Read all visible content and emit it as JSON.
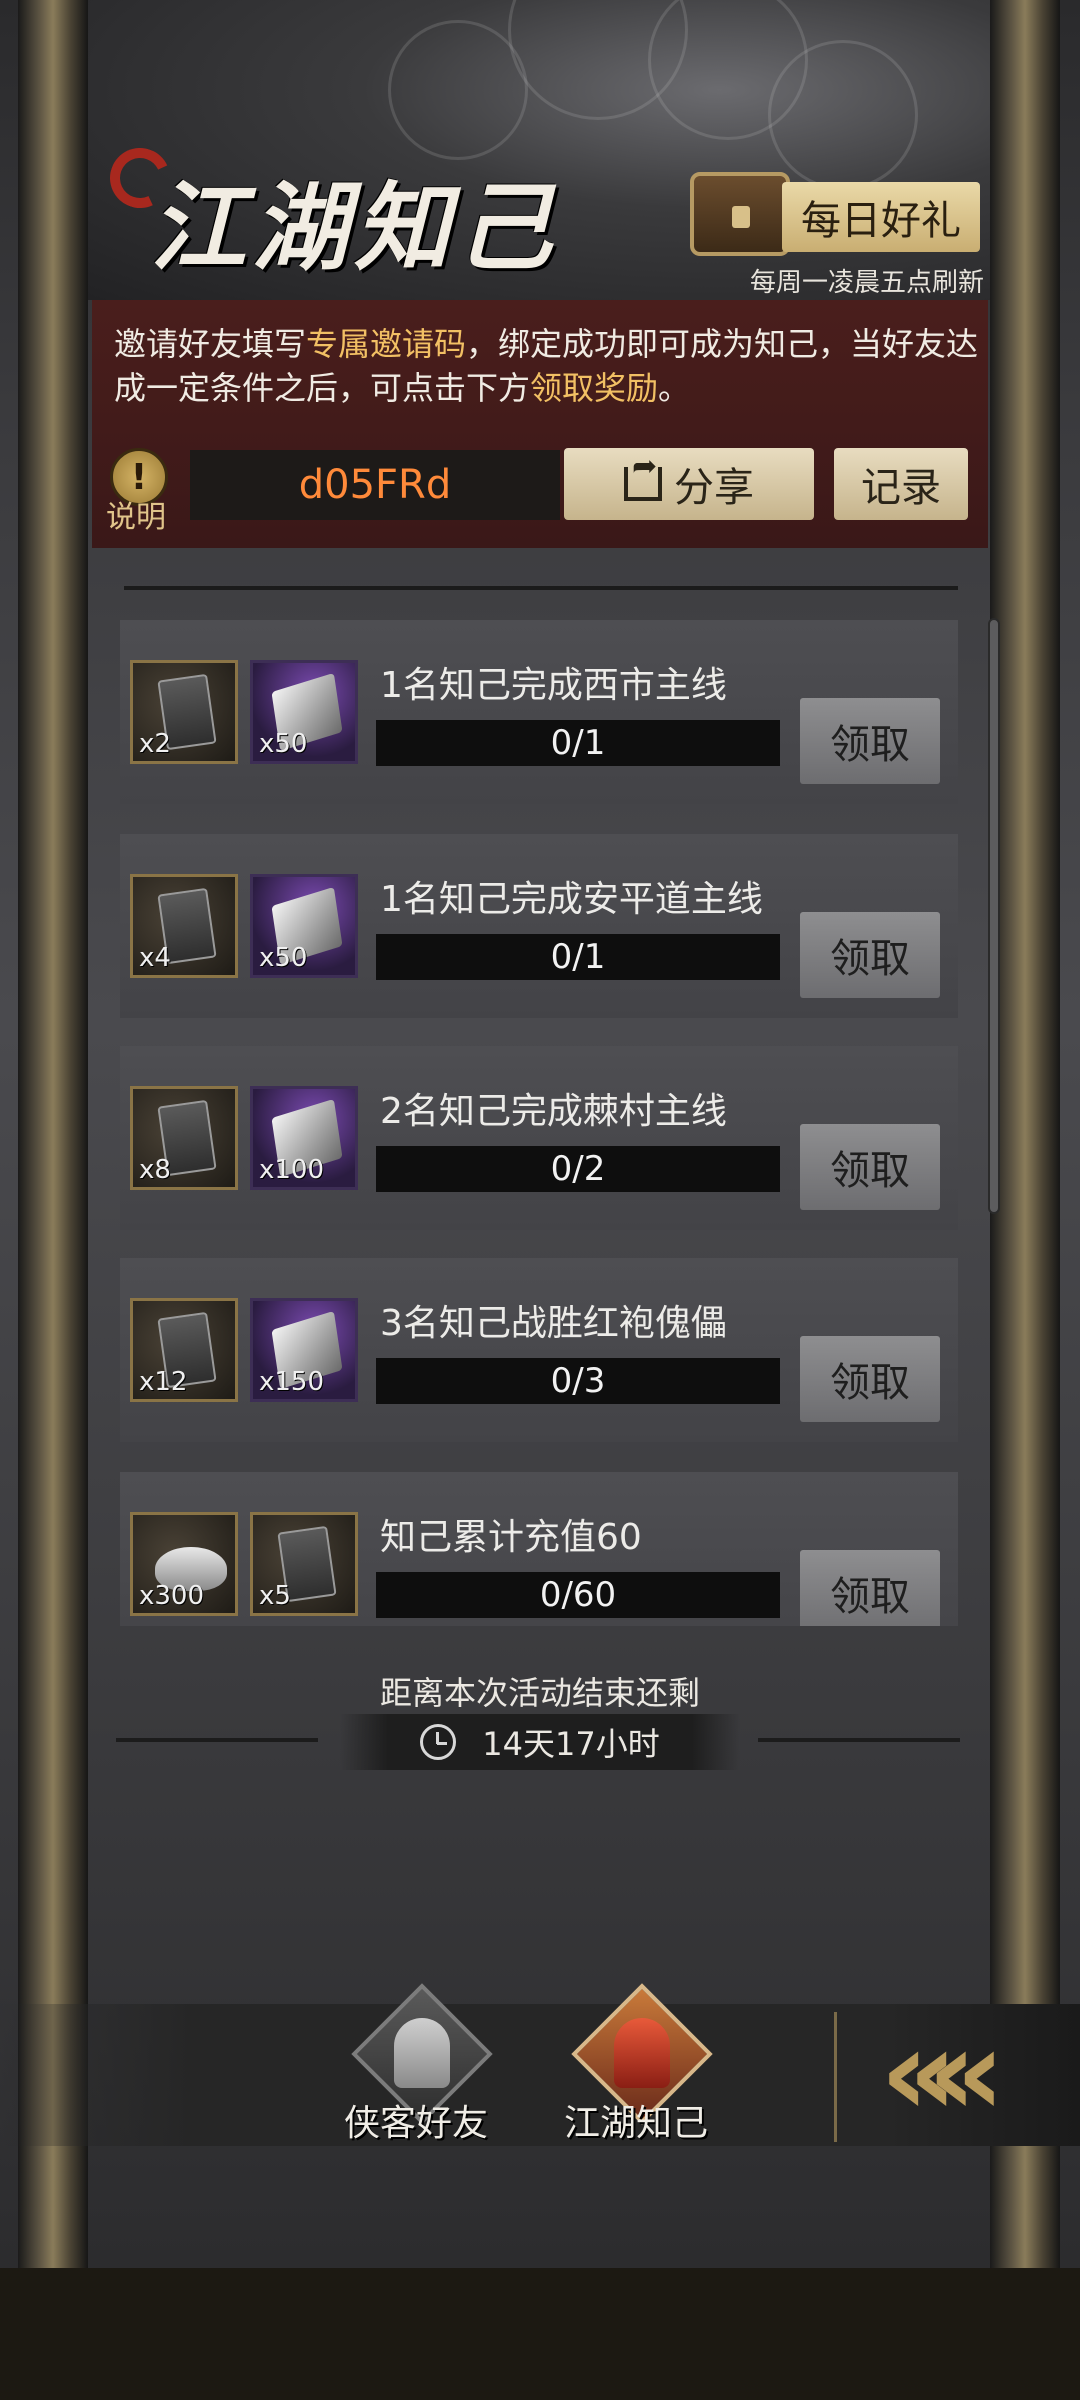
{
  "header": {
    "title": "江湖知己",
    "daily_gift_label": "每日好礼",
    "refresh_note": "每周一凌晨五点刷新"
  },
  "invite": {
    "text_part1": "邀请好友填写",
    "text_highlight1": "专属邀请码",
    "text_part2": "，绑定成功即可成为知己，当好友达成一定条件之后，可点击下方",
    "text_highlight2": "领取奖励",
    "text_part3": "。",
    "help_label": "说明",
    "code": "d05FRd",
    "share_label": "分享",
    "record_label": "记录"
  },
  "tasks": [
    {
      "title": "1名知己完成西市主线",
      "progress": "0/1",
      "claim": "领取",
      "items": [
        {
          "icon": "token-icon",
          "qty": "x2"
        },
        {
          "icon": "silver-ingot-icon",
          "qty": "x50"
        }
      ]
    },
    {
      "title": "1名知己完成安平道主线",
      "progress": "0/1",
      "claim": "领取",
      "items": [
        {
          "icon": "token-icon",
          "qty": "x4"
        },
        {
          "icon": "silver-ingot-icon",
          "qty": "x50"
        }
      ]
    },
    {
      "title": "2名知己完成棘村主线",
      "progress": "0/2",
      "claim": "领取",
      "items": [
        {
          "icon": "token-icon",
          "qty": "x8"
        },
        {
          "icon": "silver-ingot-icon",
          "qty": "x100"
        }
      ]
    },
    {
      "title": "3名知己战胜红袍傀儡",
      "progress": "0/3",
      "claim": "领取",
      "items": [
        {
          "icon": "token-icon",
          "qty": "x12"
        },
        {
          "icon": "silver-ingot-icon",
          "qty": "x150"
        }
      ]
    },
    {
      "title": "知己累计充值60",
      "progress": "0/60",
      "claim": "领取",
      "items": [
        {
          "icon": "sycee-icon",
          "qty": "x300"
        },
        {
          "icon": "token-icon",
          "qty": "x5"
        }
      ]
    }
  ],
  "countdown": {
    "label": "距离本次活动结束还剩",
    "time": "14天17小时"
  },
  "nav": {
    "tab1": "侠客好友",
    "tab2": "江湖知己",
    "active": "江湖知己",
    "back_icon": "double-chevron-left-icon"
  },
  "colors": {
    "highlight": "#f2c064",
    "code": "#ff8a3a",
    "invite_bg": "#4a1e1c"
  }
}
